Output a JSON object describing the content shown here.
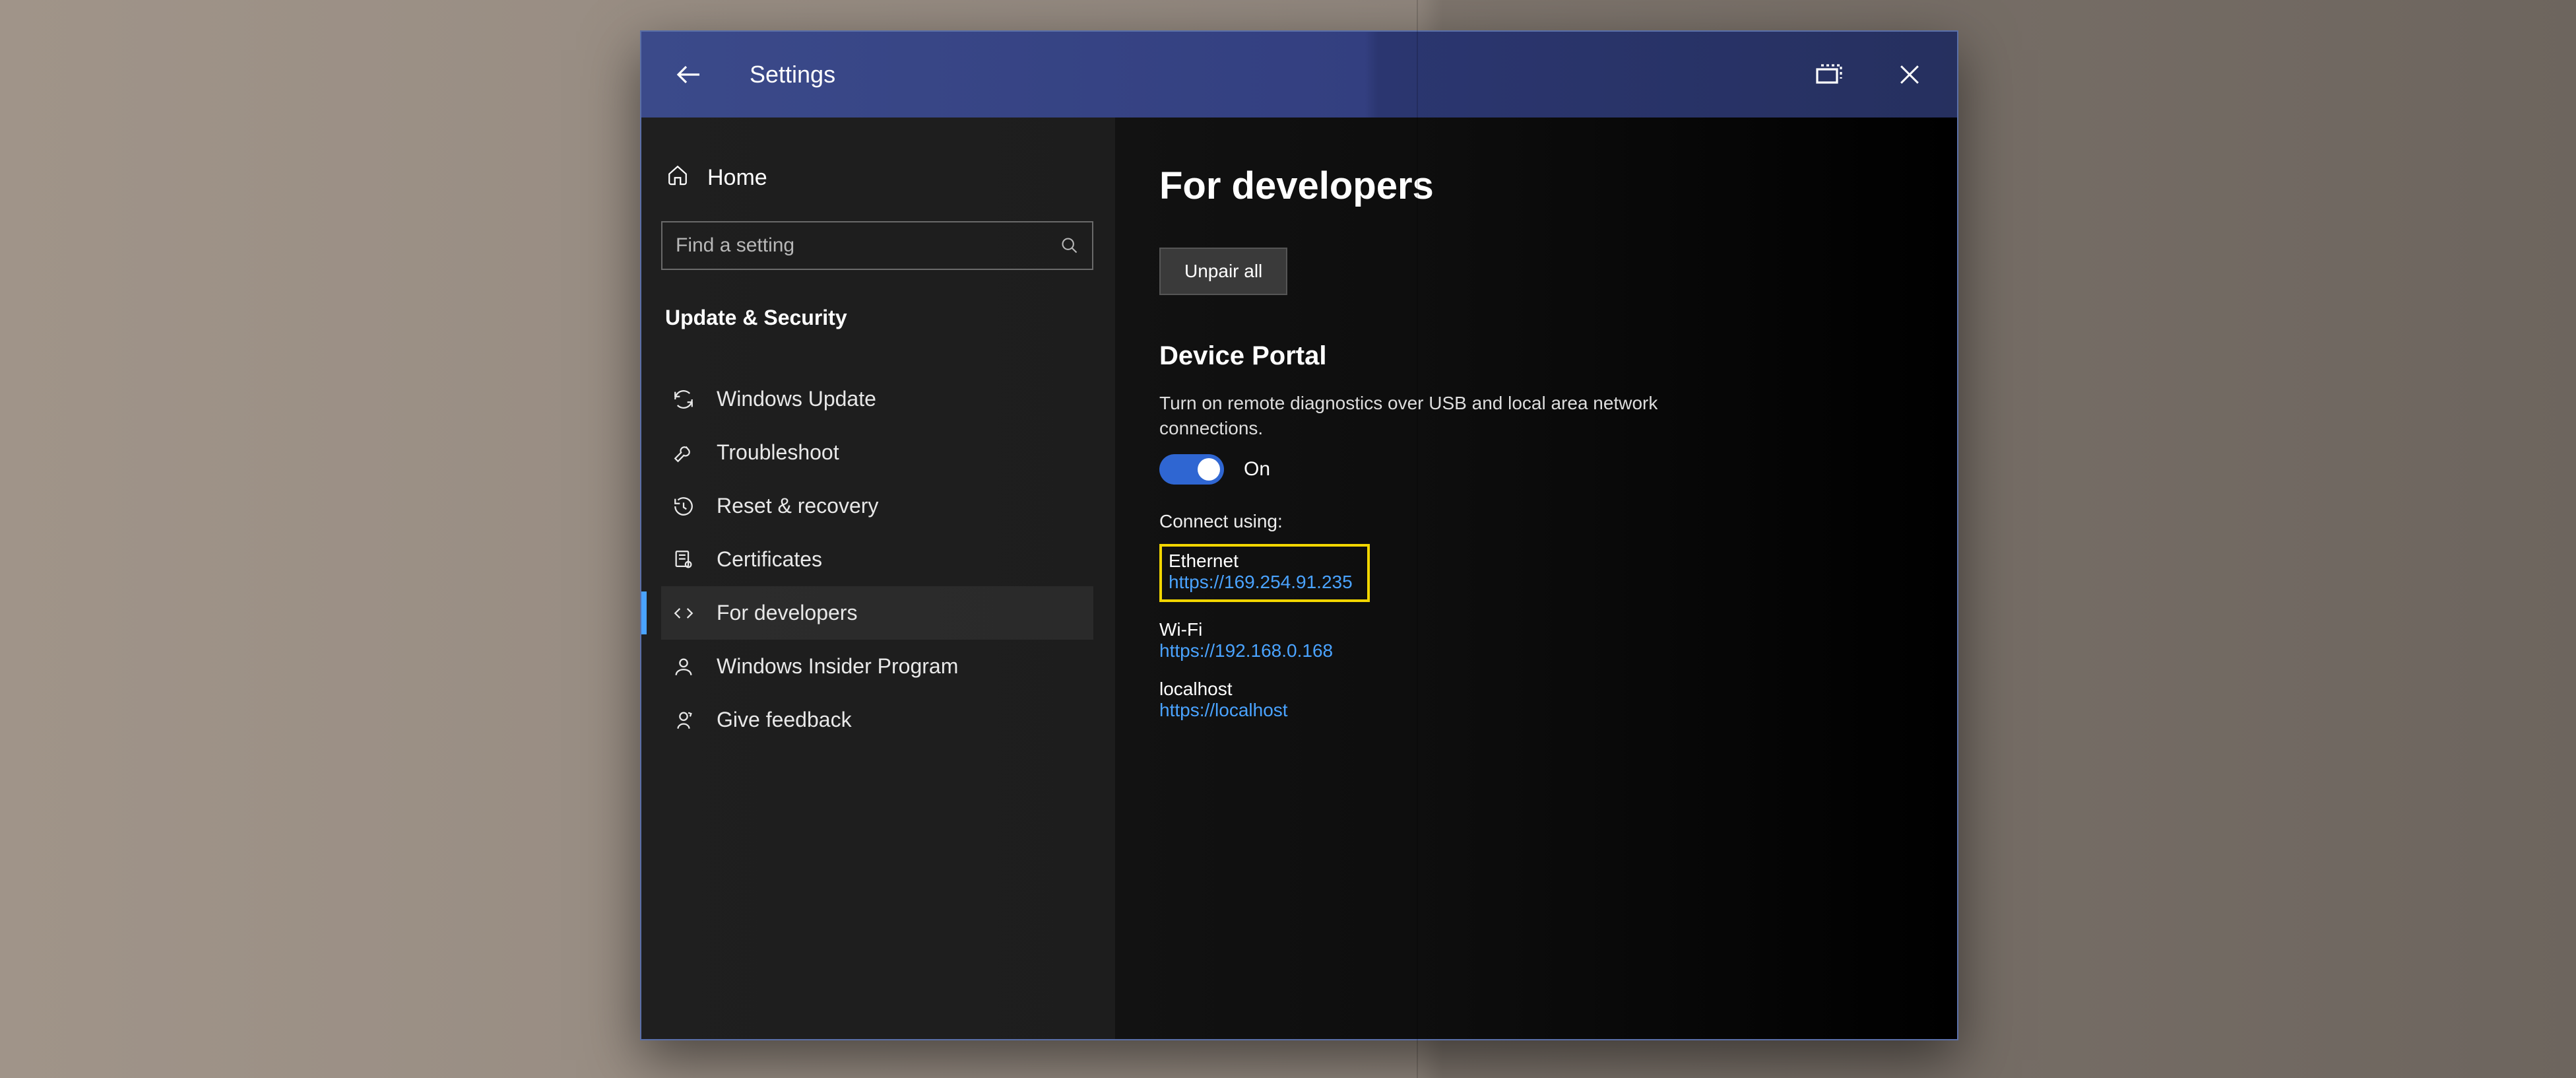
{
  "titlebar": {
    "title": "Settings"
  },
  "sidebar": {
    "home": "Home",
    "search_placeholder": "Find a setting",
    "section": "Update & Security",
    "items": [
      {
        "id": "windows-update",
        "label": "Windows Update"
      },
      {
        "id": "troubleshoot",
        "label": "Troubleshoot"
      },
      {
        "id": "reset-recovery",
        "label": "Reset & recovery"
      },
      {
        "id": "certificates",
        "label": "Certificates"
      },
      {
        "id": "for-developers",
        "label": "For developers"
      },
      {
        "id": "insider-program",
        "label": "Windows Insider Program"
      },
      {
        "id": "give-feedback",
        "label": "Give feedback"
      }
    ]
  },
  "main": {
    "heading": "For developers",
    "unpair_label": "Unpair all",
    "device_portal_heading": "Device Portal",
    "device_portal_desc": "Turn on remote diagnostics over USB and local area network connections.",
    "toggle_state": "On",
    "connect_label": "Connect using:",
    "connections": [
      {
        "name": "Ethernet",
        "url": "https://169.254.91.235",
        "highlight": true
      },
      {
        "name": "Wi-Fi",
        "url": "https://192.168.0.168",
        "highlight": false
      },
      {
        "name": "localhost",
        "url": "https://localhost",
        "highlight": false
      }
    ]
  }
}
